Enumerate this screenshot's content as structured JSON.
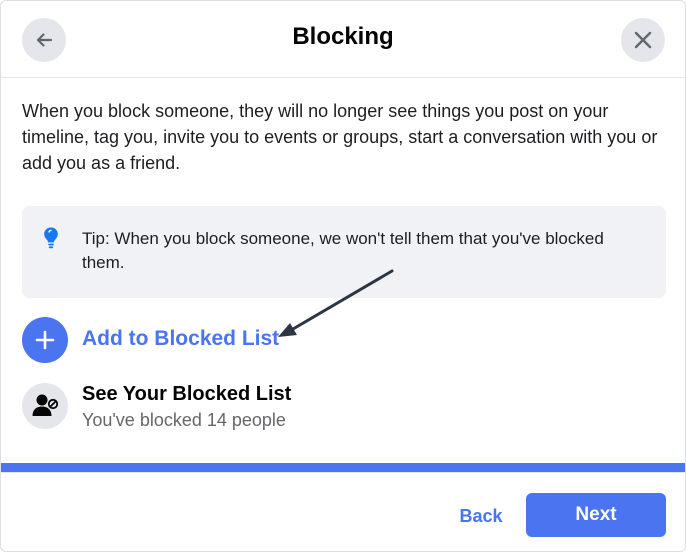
{
  "header": {
    "title": "Blocking",
    "back_icon": "arrow-left-icon",
    "close_icon": "close-icon"
  },
  "description": "When you block someone, they will no longer see things you post on your timeline, tag you, invite you to events or groups, start a conversation with you or add you as a friend.",
  "tip": {
    "icon": "lightbulb-icon",
    "text": "Tip: When you block someone, we won't tell them that you've blocked them."
  },
  "actions": {
    "add": {
      "label": "Add to Blocked List",
      "icon": "plus-icon"
    },
    "see": {
      "title": "See Your Blocked List",
      "subtitle": "You've blocked 14 people",
      "icon": "blocked-user-icon"
    }
  },
  "annotation": {
    "icon": "arrow-annotation"
  },
  "progress": {
    "fraction": 1.0
  },
  "footer": {
    "back_label": "Back",
    "next_label": "Next"
  },
  "colors": {
    "accent": "#4a74f0",
    "surface": "#f0f2f5",
    "icon_bg": "#e4e6eb",
    "text_secondary": "#65676b",
    "annotation_arrow": "#2b3544"
  }
}
